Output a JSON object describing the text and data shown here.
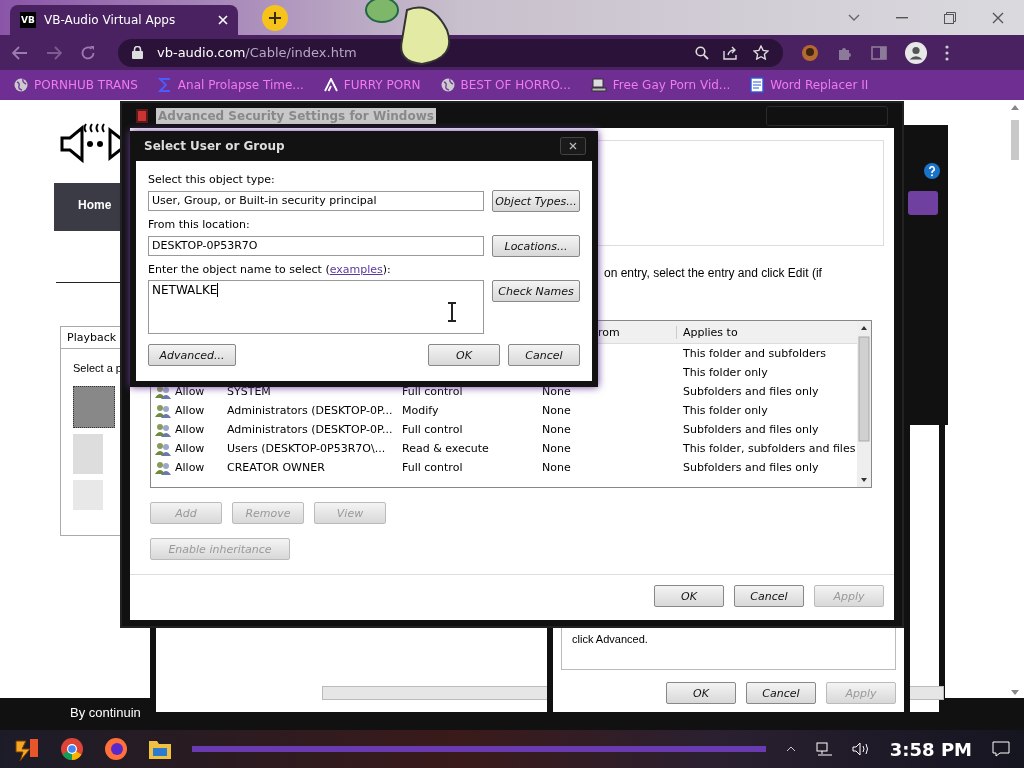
{
  "browser": {
    "tab": {
      "favicon_text": "VB",
      "title": "VB-Audio Virtual Apps"
    },
    "url": {
      "domain": "vb-audio.com",
      "path": "/Cable/index.htm"
    },
    "bookmarks": [
      {
        "label": "PORNHUB TRANS",
        "kind": "globe"
      },
      {
        "label": "Anal Prolapse Time...",
        "kind": "sigma"
      },
      {
        "label": "FURRY PORN",
        "kind": "lambda"
      },
      {
        "label": "BEST OF HORRO...",
        "kind": "globe"
      },
      {
        "label": "Free Gay Porn Vid...",
        "kind": "computer"
      },
      {
        "label": "Word Replacer II",
        "kind": "wr"
      }
    ]
  },
  "page": {
    "nav_item": "Home",
    "footer_text": "By continuin"
  },
  "sound_dialog": {
    "tab": "Playback",
    "prompt": "Select a p"
  },
  "back_dialog": {
    "text": "click Advanced.",
    "buttons": [
      {
        "label": "OK",
        "disabled": false
      },
      {
        "label": "Cancel",
        "disabled": false
      },
      {
        "label": "Apply",
        "disabled": true
      }
    ]
  },
  "security_window": {
    "title": "Advanced Security Settings for Windows",
    "instruction": "on entry, select the entry and click Edit (if",
    "columns": {
      "inherited": "rom",
      "applies_to": "Applies to"
    },
    "rows": [
      {
        "applies_to": "This folder and subfolders"
      },
      {
        "applies_to": "This folder only"
      },
      {
        "type": "Allow",
        "principal": "SYSTEM",
        "access": "Full control",
        "inherited": "None",
        "applies_to": "Subfolders and files only"
      },
      {
        "type": "Allow",
        "principal": "Administrators (DESKTOP-0P...",
        "access": "Modify",
        "inherited": "None",
        "applies_to": "This folder only"
      },
      {
        "type": "Allow",
        "principal": "Administrators (DESKTOP-0P...",
        "access": "Full control",
        "inherited": "None",
        "applies_to": "Subfolders and files only"
      },
      {
        "type": "Allow",
        "principal": "Users (DESKTOP-0P53R7O\\...",
        "access": "Read & execute",
        "inherited": "None",
        "applies_to": "This folder, subfolders and files"
      },
      {
        "type": "Allow",
        "principal": "CREATOR OWNER",
        "access": "Full control",
        "inherited": "None",
        "applies_to": "Subfolders and files only"
      }
    ],
    "entry_buttons": [
      {
        "label": "Add",
        "disabled": true
      },
      {
        "label": "Remove",
        "disabled": true
      },
      {
        "label": "View",
        "disabled": true
      }
    ],
    "inheritance_button": {
      "label": "Enable inheritance",
      "disabled": true
    },
    "buttons": [
      {
        "label": "OK",
        "disabled": false
      },
      {
        "label": "Cancel",
        "disabled": false
      },
      {
        "label": "Apply",
        "disabled": true
      }
    ]
  },
  "select_dialog": {
    "title": "Select User or Group",
    "object_type_label": "Select this object type:",
    "object_type": "User, Group, or Built-in security principal",
    "object_types_button": "Object Types...",
    "location_label": "From this location:",
    "location": "DESKTOP-0P53R7O",
    "locations_button": "Locations...",
    "name_label": "Enter the object name to select (",
    "examples_link": "examples",
    "name_label_end": "):",
    "name_value": "NETWALKE",
    "check_names_button": "Check Names",
    "advanced_button": "Advanced...",
    "ok_button": "OK",
    "cancel_button": "Cancel"
  },
  "taskbar": {
    "time": "3:58 PM"
  }
}
